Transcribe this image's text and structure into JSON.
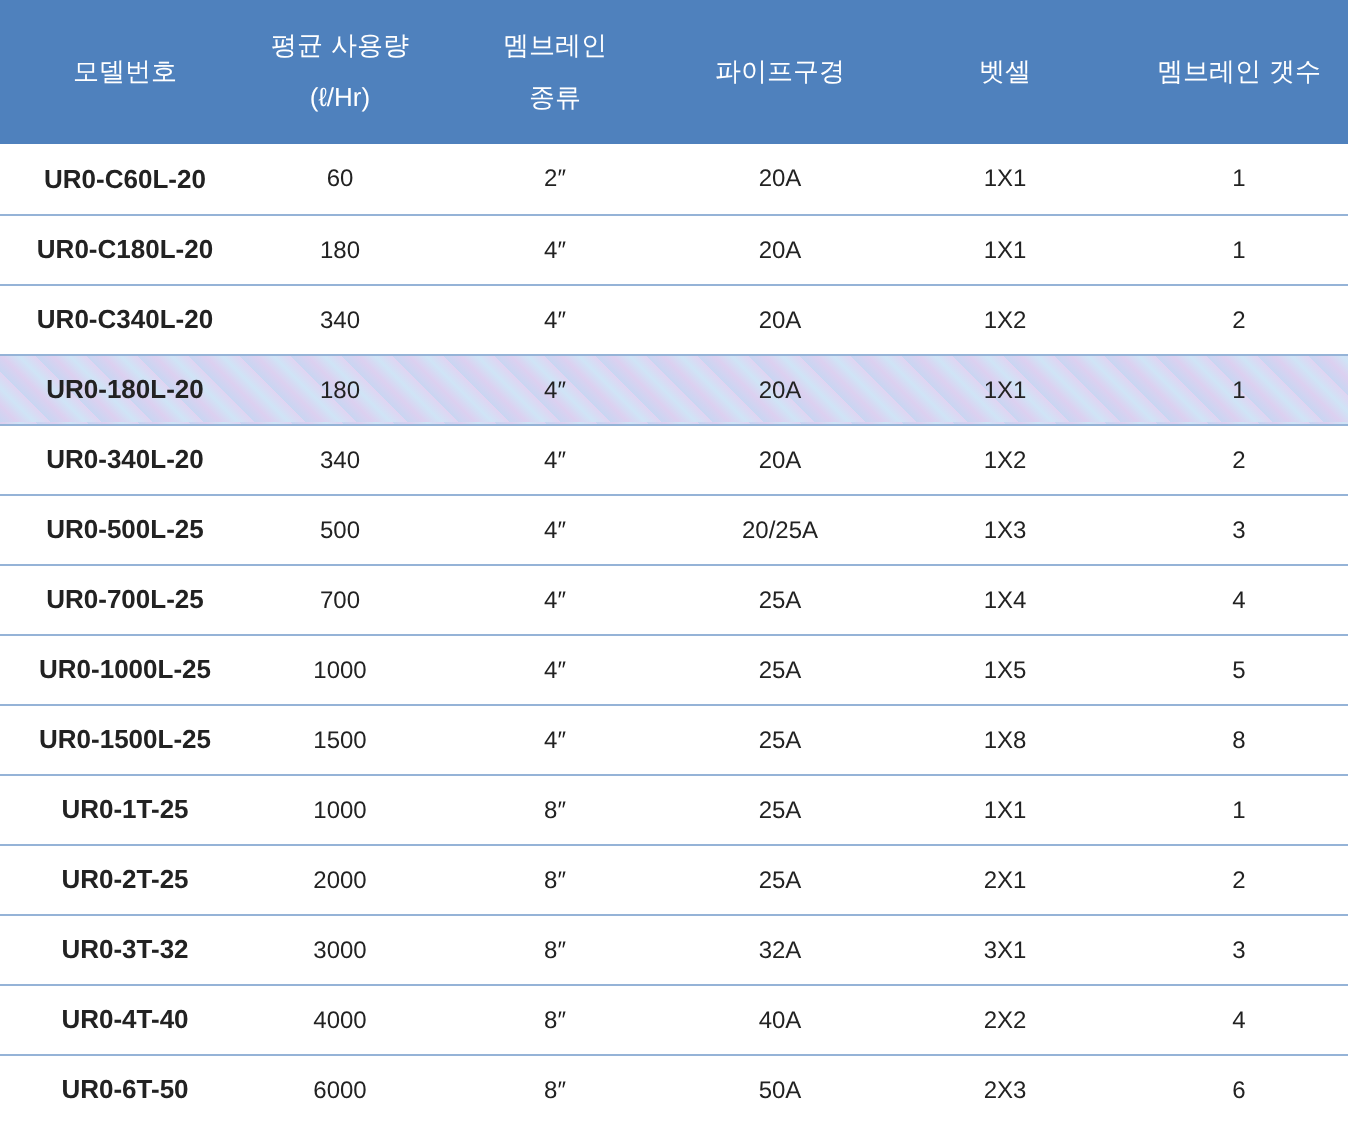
{
  "table": {
    "columns": [
      "모델번호",
      "평균 사용량\n(ℓ/Hr)",
      "멤브레인\n종류",
      "파이프구경",
      "벳셀",
      "멤브레인 갯수"
    ],
    "rows": [
      {
        "selected": false,
        "cells": [
          "UR0-C60L-20",
          "60",
          "2″",
          "20A",
          "1X1",
          "1"
        ]
      },
      {
        "selected": false,
        "cells": [
          "UR0-C180L-20",
          "180",
          "4″",
          "20A",
          "1X1",
          "1"
        ]
      },
      {
        "selected": false,
        "cells": [
          "UR0-C340L-20",
          "340",
          "4″",
          "20A",
          "1X2",
          "2"
        ]
      },
      {
        "selected": true,
        "cells": [
          "UR0-180L-20",
          "180",
          "4″",
          "20A",
          "1X1",
          "1"
        ]
      },
      {
        "selected": false,
        "cells": [
          "UR0-340L-20",
          "340",
          "4″",
          "20A",
          "1X2",
          "2"
        ]
      },
      {
        "selected": false,
        "cells": [
          "UR0-500L-25",
          "500",
          "4″",
          "20/25A",
          "1X3",
          "3"
        ]
      },
      {
        "selected": false,
        "cells": [
          "UR0-700L-25",
          "700",
          "4″",
          "25A",
          "1X4",
          "4"
        ]
      },
      {
        "selected": false,
        "cells": [
          "UR0-1000L-25",
          "1000",
          "4″",
          "25A",
          "1X5",
          "5"
        ]
      },
      {
        "selected": false,
        "cells": [
          "UR0-1500L-25",
          "1500",
          "4″",
          "25A",
          "1X8",
          "8"
        ]
      },
      {
        "selected": false,
        "cells": [
          "UR0-1T-25",
          "1000",
          "8″",
          "25A",
          "1X1",
          "1"
        ]
      },
      {
        "selected": false,
        "cells": [
          "UR0-2T-25",
          "2000",
          "8″",
          "25A",
          "2X1",
          "2"
        ]
      },
      {
        "selected": false,
        "cells": [
          "UR0-3T-32",
          "3000",
          "8″",
          "32A",
          "3X1",
          "3"
        ]
      },
      {
        "selected": false,
        "cells": [
          "UR0-4T-40",
          "4000",
          "8″",
          "40A",
          "2X2",
          "4"
        ]
      },
      {
        "selected": false,
        "cells": [
          "UR0-6T-50",
          "6000",
          "8″",
          "50A",
          "2X3",
          "6"
        ]
      }
    ]
  }
}
